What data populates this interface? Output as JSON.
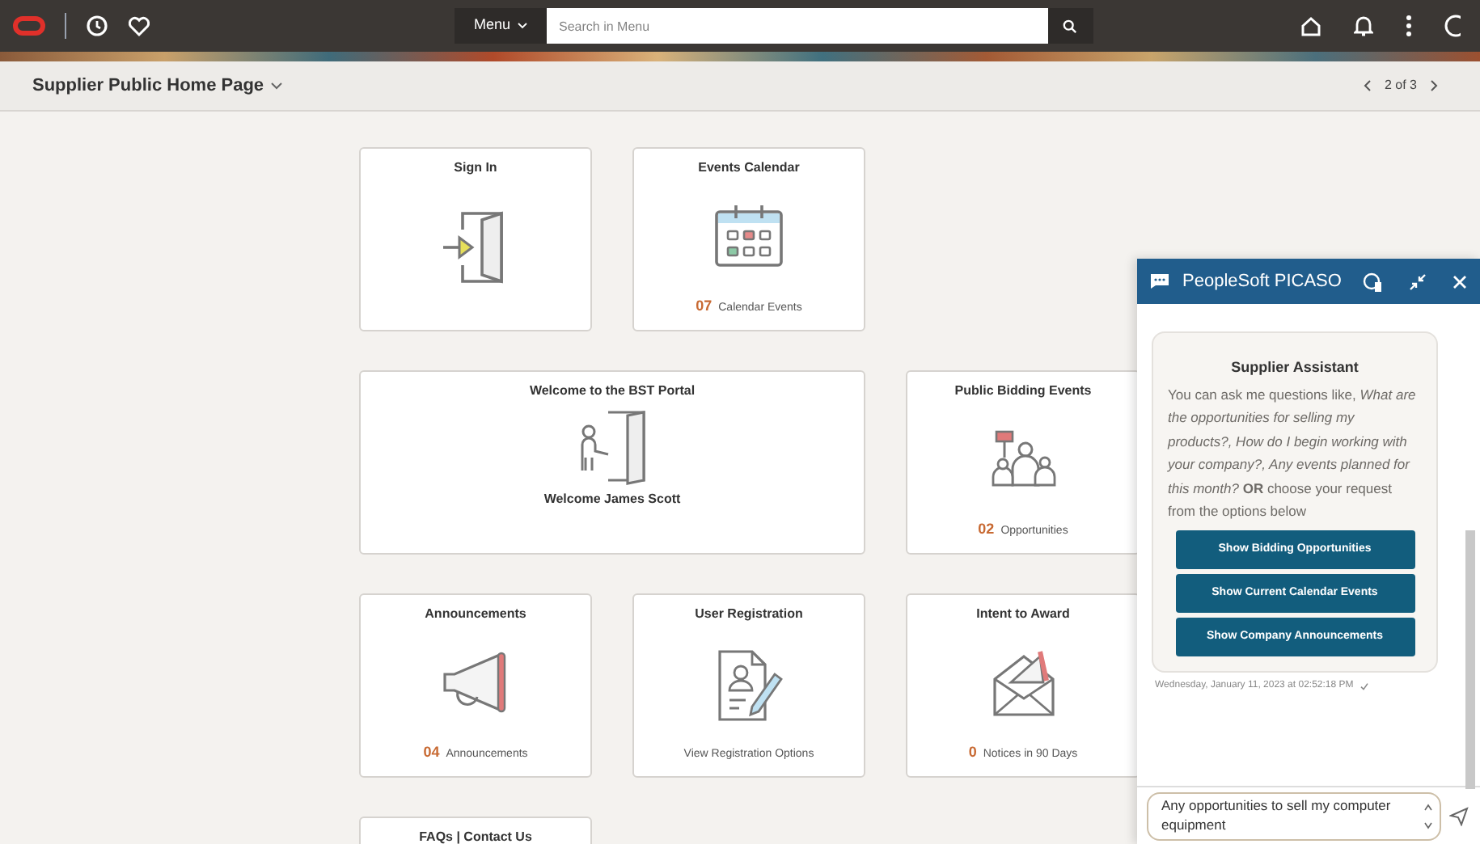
{
  "header": {
    "menu_label": "Menu",
    "search_placeholder": "Search in Menu"
  },
  "page_title": "Supplier Public Home Page",
  "pager": "2 of 3",
  "tiles": [
    {
      "kind": "signin",
      "title": "Sign In"
    },
    {
      "kind": "calendar",
      "title": "Events Calendar",
      "count": "07",
      "count_label": "Calendar Events"
    },
    {
      "kind": "welcome",
      "title": "Welcome to the BST Portal",
      "subtitle": "Welcome James Scott"
    },
    {
      "kind": "bidding",
      "title": "Public Bidding Events",
      "count": "02",
      "count_label": "Opportunities"
    },
    {
      "kind": "announcements",
      "title": "Announcements",
      "count": "04",
      "count_label": "Announcements"
    },
    {
      "kind": "registration",
      "title": "User Registration",
      "count_label": "View Registration Options"
    },
    {
      "kind": "award",
      "title": "Intent to Award",
      "count": "0",
      "count_label": "Notices in 90 Days"
    },
    {
      "kind": "faq",
      "title": "FAQs | Contact Us"
    }
  ],
  "chat": {
    "title": "PeopleSoft PICASO",
    "card_title": "Supplier Assistant",
    "message": "You can ask me questions like, *What are the opportunities for selling my products?, How do I begin working with your company?, Any events planned for this month?* **OR** choose your request from the options below",
    "options": [
      "Show Bidding Opportunities",
      "Show Current Calendar Events",
      "Show Company Announcements"
    ],
    "timestamp": "Wednesday, January 11, 2023 at 02:52:18 PM",
    "input_value": "Any opportunities to sell my computer equipment"
  }
}
